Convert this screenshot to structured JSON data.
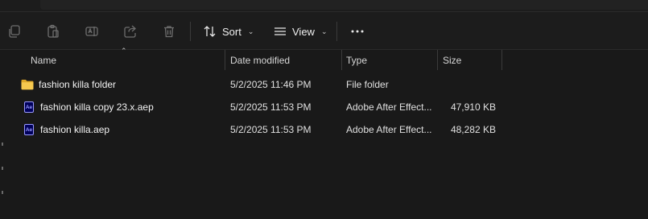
{
  "toolbar": {
    "sort_label": "Sort",
    "view_label": "View"
  },
  "columns": {
    "name": "Name",
    "date_modified": "Date modified",
    "type": "Type",
    "size": "Size"
  },
  "files": [
    {
      "name": "fashion killa folder",
      "date": "5/2/2025 11:46 PM",
      "type": "File folder",
      "size": "",
      "icon": "folder-icon"
    },
    {
      "name": "fashion killa copy 23.x.aep",
      "date": "5/2/2025 11:53 PM",
      "type": "Adobe After Effect...",
      "size": "47,910 KB",
      "icon": "after-effects-icon"
    },
    {
      "name": "fashion killa.aep",
      "date": "5/2/2025 11:53 PM",
      "type": "Adobe After Effect...",
      "size": "48,282 KB",
      "icon": "after-effects-icon"
    }
  ],
  "icons": {
    "ae_glyph": "Ae"
  },
  "colors": {
    "background": "#191919",
    "folder": "#f0c24a",
    "ae_accent": "#9999ff",
    "ae_bg": "#00005b"
  }
}
